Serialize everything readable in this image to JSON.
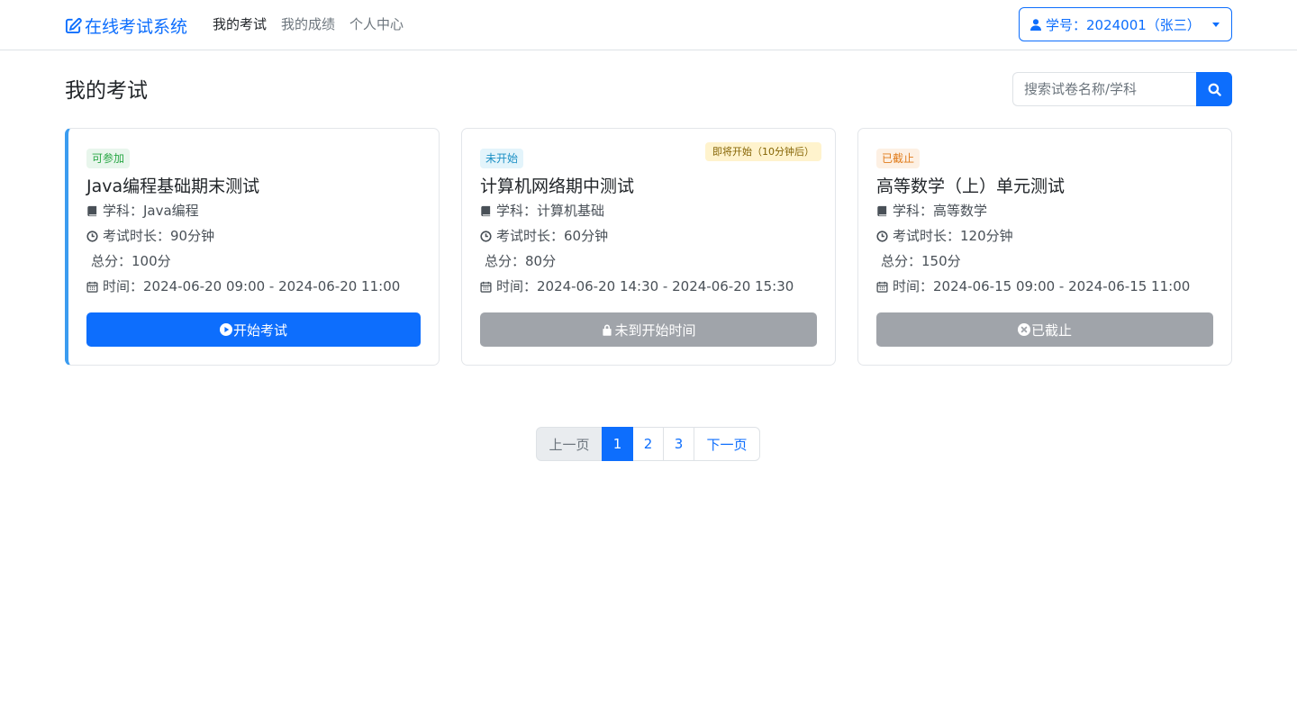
{
  "navbar": {
    "brand": "在线考试系统",
    "links": [
      "我的考试",
      "我的成绩",
      "个人中心"
    ],
    "user": "学号：2024001（张三）"
  },
  "header": {
    "title": "我的考试",
    "search_placeholder": "搜索试卷名称/学科"
  },
  "exams": [
    {
      "status": "可参加",
      "title": "Java编程基础期末测试",
      "subject": "学科：Java编程",
      "duration": "考试时长：90分钟",
      "score": "总分：100分",
      "time": "时间：2024-06-20 09:00 - 2024-06-20 11:00",
      "button": "开始考试"
    },
    {
      "status": "未开始",
      "notice": "即将开始（10分钟后）",
      "title": "计算机网络期中测试",
      "subject": "学科：计算机基础",
      "duration": "考试时长：60分钟",
      "score": "总分：80分",
      "time": "时间：2024-06-20 14:30 - 2024-06-20 15:30",
      "button": "未到开始时间"
    },
    {
      "status": "已截止",
      "title": "高等数学（上）单元测试",
      "subject": "学科：高等数学",
      "duration": "考试时长：120分钟",
      "score": "总分：150分",
      "time": "时间：2024-06-15 09:00 - 2024-06-15 11:00",
      "button": "已截止"
    }
  ],
  "pagination": {
    "prev": "上一页",
    "pages": [
      "1",
      "2",
      "3"
    ],
    "next": "下一页"
  },
  "colors": {
    "primary": "#0d6efd",
    "disabled": "#a0a4aa",
    "available": "#28a745",
    "pending": "#1a8fc4",
    "closed": "#e07b1a"
  }
}
